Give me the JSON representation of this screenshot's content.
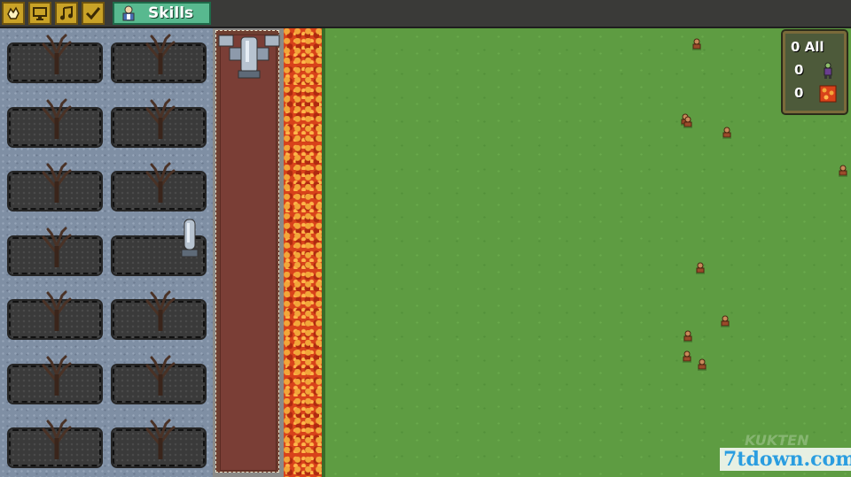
{
  "toolbar": {
    "buttons": [
      {
        "name": "build-button",
        "icon": "hand-icon"
      },
      {
        "name": "monitor-button",
        "icon": "monitor-icon"
      },
      {
        "name": "music-button",
        "icon": "music-note-icon"
      },
      {
        "name": "check-button",
        "icon": "checkmark-icon"
      }
    ],
    "skills_tab": {
      "label": "Skills",
      "icon": "scientist-icon"
    }
  },
  "graveyard": {
    "plots": [
      {
        "content": "dead-tree-icon"
      },
      {
        "content": "dead-tree-icon"
      },
      {
        "content": "dead-tree-icon"
      },
      {
        "content": "dead-tree-icon"
      },
      {
        "content": "dead-tree-icon"
      },
      {
        "content": "dead-tree-icon"
      },
      {
        "content": "dead-tree-icon"
      },
      {
        "content": "tombstone-icon"
      },
      {
        "content": "dead-tree-icon"
      },
      {
        "content": "dead-tree-icon"
      },
      {
        "content": "dead-tree-icon"
      },
      {
        "content": "dead-tree-icon"
      },
      {
        "content": "dead-tree-icon"
      },
      {
        "content": "dead-tree-icon"
      }
    ]
  },
  "road": {
    "spawner": "cross-tombstone-icon"
  },
  "stats_panel": {
    "all": {
      "value": "0",
      "label": "All"
    },
    "zombies": {
      "value": "0",
      "icon": "zombie-icon"
    },
    "lava": {
      "value": "0",
      "icon": "lava-icon"
    }
  },
  "field": {
    "enemy_count": 10,
    "enemy_icon": "villager-icon"
  },
  "colors": {
    "grass": "#5e9c42",
    "lava": "#d8421a",
    "road": "#7a3e36",
    "stone": "#7f8fa4",
    "gold": "#c9a227",
    "skills": "#58b98f"
  },
  "watermark": {
    "text": "7tdown.com"
  }
}
